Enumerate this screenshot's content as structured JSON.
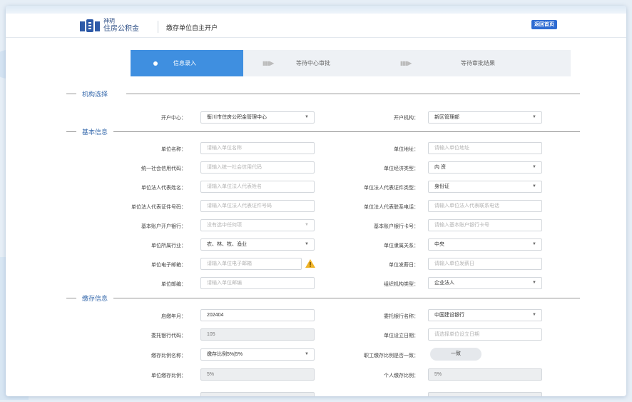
{
  "header": {
    "logo_line1": "神玥",
    "logo_line2": "住房公积金",
    "page_title": "缴存单位自主开户",
    "home_button": "返回首页"
  },
  "steps": [
    {
      "label": "信息录入",
      "active": true
    },
    {
      "label": "等待中心审批",
      "active": false
    },
    {
      "label": "等待审批结果",
      "active": false
    }
  ],
  "sections": {
    "org": "机构选择",
    "basic": "基本信息",
    "deposit": "缴存信息"
  },
  "org": {
    "center_label": "开户中心：",
    "center_value": "衡川市住房公积金管理中心",
    "branch_label": "开户机构：",
    "branch_value": "新区管理部"
  },
  "basic": {
    "name_label": "单位名称：",
    "name_ph": "请输入单位名称",
    "address_label": "单位地址：",
    "address_ph": "请输入单位地址",
    "credit_label": "统一社会信用代码：",
    "credit_ph": "请输入统一社会信用代码",
    "econ_label": "单位经济类型：",
    "econ_value": "内 资",
    "legal_name_label": "单位法人代表姓名：",
    "legal_name_ph": "请输入单位法人代表姓名",
    "legal_idtype_label": "单位法人代表证件类型：",
    "legal_idtype_value": "身份证",
    "legal_id_label": "单位法人代表证件号码：",
    "legal_id_ph": "请输入单位法人代表证件号码",
    "legal_phone_label": "单位法人代表联系电话：",
    "legal_phone_ph": "请输入单位法人代表联系电话",
    "bank_label": "基本账户开户银行：",
    "bank_ph": "没有选中任何项",
    "bank_acct_label": "基本账户银行卡号：",
    "bank_acct_ph": "请输入基本账户银行卡号",
    "industry_label": "单位所属行业：",
    "industry_value": "农、林、牧、渔业",
    "affil_label": "单位隶属关系：",
    "affil_value": "中央",
    "email_label": "单位电子邮箱：",
    "email_ph": "请输入单位电子邮箱",
    "payday_label": "单位发薪日：",
    "payday_ph": "请输入单位发薪日",
    "zip_label": "单位邮编：",
    "zip_ph": "请输入单位邮编",
    "orgtype_label": "组织机构类型：",
    "orgtype_value": "企业法人"
  },
  "deposit": {
    "start_label": "启缴年月：",
    "start_value": "202404",
    "entrust_label": "委托银行名称：",
    "entrust_value": "中国建设银行",
    "entrust_code_label": "委托银行代码：",
    "entrust_code_value": "105",
    "setup_label": "单位设立日期：",
    "setup_ph": "请选择单位设立日期",
    "ratio_name_label": "缴存比例名称：",
    "ratio_name_value": "缴存比例5%|5%",
    "consistent_label": "职工缴存比例是否一致：",
    "consistent_value": "一致",
    "unit_ratio_label": "单位缴存比例：",
    "unit_ratio_value": "5%",
    "person_ratio_label": "个人缴存比例：",
    "person_ratio_value": "5%"
  },
  "colors": {
    "accent": "#3f8fe0",
    "home_button": "#2d6bd2",
    "section_title": "#3a6cae",
    "warning": "#f0b429"
  },
  "icons": {
    "logo": "housing-fund-logo",
    "step_dot": "circle-dot-icon",
    "dropdown": "caret-down-icon",
    "warning": "warning-triangle-icon"
  }
}
